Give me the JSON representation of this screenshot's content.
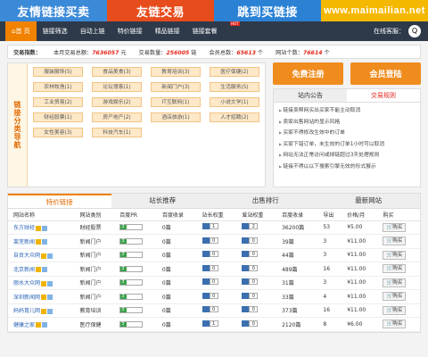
{
  "banner": [
    "友情链接买卖",
    "友链交易",
    "跳到买链接",
    "www.maimailian.net"
  ],
  "nav": {
    "items": [
      "首 页",
      "链接筛选",
      "自动上链",
      "特价链接",
      "精品链接",
      "链接套餐"
    ],
    "hot": "HOT",
    "right_label": "在线客服：",
    "qq": "Q"
  },
  "stats": {
    "title": "交易指数：",
    "items": [
      {
        "label": "本月交易总额：",
        "value": "7636057",
        "unit": "元"
      },
      {
        "label": "交易数量：",
        "value": "256005",
        "unit": "链"
      },
      {
        "label": "会员总数：",
        "value": "65613",
        "unit": "个"
      },
      {
        "label": "网站个数：",
        "value": "76614",
        "unit": "个"
      }
    ]
  },
  "categories": {
    "side_label": "链接分类导航",
    "items": [
      "服装服饰(5)",
      "食品美食(3)",
      "教育培训(3)",
      "医疗保健(2)",
      "农林牧渔(1)",
      "论坛博客(1)",
      "新闻门户(3)",
      "生活服务(5)",
      "工业贸易(2)",
      "游戏娱乐(2)",
      "IT互联网(1)",
      "小说文学(1)",
      "财经股票(1)",
      "房产地产(2)",
      "酒店旅游(1)",
      "人才招聘(2)",
      "女性美容(3)",
      "科技汽车(1)"
    ]
  },
  "buttons": {
    "register": "免费注册",
    "login": "会员登陆"
  },
  "notice": {
    "tabs": [
      "站内公告",
      "交易规则"
    ],
    "lines": [
      "链接卖帮网买出买家不能主动取消",
      "卖家出售网站的显示风格",
      "买家不得修改生效中的订单",
      "买家下错订单，未生效的订单1小时可以取消",
      "网站无法正常访问或掉链超过3天处理规则",
      "链接不得以以下搜索引擎无效的形式展示"
    ]
  },
  "table": {
    "tabs": [
      "特价链接",
      "站长推荐",
      "出售排行",
      "最新网站"
    ],
    "headers": [
      "网站名称",
      "网站类别",
      "百度PR",
      "百度收录",
      "站长权重",
      "爱站权重",
      "百度收录",
      "导出",
      "价格/月",
      "购买"
    ],
    "buy_label": "购买",
    "rows": [
      {
        "name": "东方财经",
        "cat": "财经股票",
        "pr": "3",
        "bd": "0篇",
        "w1": "1",
        "w2": "2",
        "inc": "36200篇",
        "out": "53",
        "price": "¥5.00"
      },
      {
        "name": "莱芜新闻",
        "cat": "新闻门户",
        "pr": "3",
        "bd": "0篇",
        "w1": "0",
        "w2": "0",
        "inc": "39篇",
        "out": "3",
        "price": "¥11.00"
      },
      {
        "name": "自贡大众网",
        "cat": "新闻门户",
        "pr": "3",
        "bd": "0篇",
        "w1": "0",
        "w2": "0",
        "inc": "44篇",
        "out": "3",
        "price": "¥11.00"
      },
      {
        "name": "北京新闻",
        "cat": "新闻门户",
        "pr": "3",
        "bd": "0篇",
        "w1": "0",
        "w2": "0",
        "inc": "489篇",
        "out": "16",
        "price": "¥11.00"
      },
      {
        "name": "丽水大众网",
        "cat": "新闻门户",
        "pr": "3",
        "bd": "0篇",
        "w1": "0",
        "w2": "0",
        "inc": "31篇",
        "out": "3",
        "price": "¥11.00"
      },
      {
        "name": "深圳新闻网",
        "cat": "新闻门户",
        "pr": "3",
        "bd": "0篇",
        "w1": "0",
        "w2": "0",
        "inc": "33篇",
        "out": "4",
        "price": "¥11.00"
      },
      {
        "name": "妈妈育儿网",
        "cat": "教育培训",
        "pr": "3",
        "bd": "0篇",
        "w1": "0",
        "w2": "0",
        "inc": "373篇",
        "out": "16",
        "price": "¥11.00"
      },
      {
        "name": "健康之家",
        "cat": "医疗保健",
        "pr": "3",
        "bd": "0篇",
        "w1": "1",
        "w2": "0",
        "inc": "2120篇",
        "out": "8",
        "price": "¥6.00"
      }
    ]
  }
}
